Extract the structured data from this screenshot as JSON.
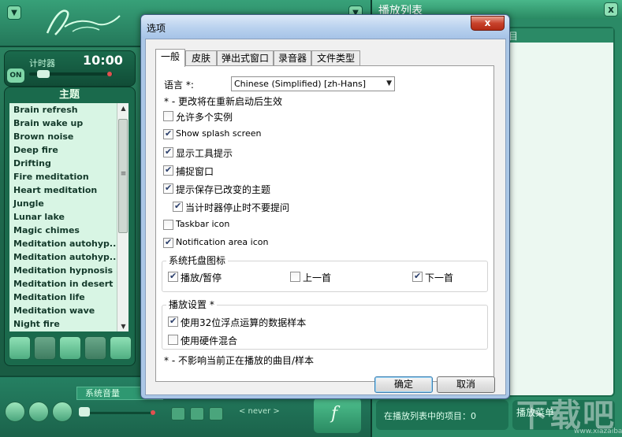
{
  "player": {
    "menu_glyph": "▼",
    "top_right_glyph": "▼",
    "timer": {
      "on_label": "ON",
      "label": "计时器",
      "value": "10:00"
    },
    "theme": {
      "title": "主题",
      "items": [
        "Brain refresh",
        "Brain wake up",
        "Brown noise",
        "Deep fire",
        "Drifting",
        "Fire meditation",
        "Heart meditation",
        "Jungle",
        "Lunar lake",
        "Magic chimes",
        "Meditation autohyp...",
        "Meditation autohyp...",
        "Meditation hypnosis",
        "Meditation in desert",
        "Meditation life",
        "Meditation wave",
        "Night fire"
      ]
    },
    "volume_label": "系统音量",
    "never_label": "< never >"
  },
  "playlist": {
    "title": "播放列表",
    "close_glyph": "x",
    "header_fragment": "目",
    "status": "在播放列表中的项目：0",
    "menu": "播放菜单",
    "watermark": "下载吧",
    "watermark_url": "www.xiazaiba.com"
  },
  "dialog": {
    "title": "选项",
    "close_glyph": "x",
    "tabs": [
      "一般",
      "皮肤",
      "弹出式窗口",
      "录音器",
      "文件类型"
    ],
    "language_label": "语言 *:",
    "language_value": "Chinese (Simplified) [zh-Hans]",
    "restart_note": "* - 更改将在重新启动后生效",
    "options": [
      {
        "label": "允许多个实例",
        "checked": false
      },
      {
        "label": "Show splash screen",
        "checked": true
      },
      {
        "label": "显示工具提示",
        "checked": true
      },
      {
        "label": "捕捉窗口",
        "checked": true
      },
      {
        "label": "提示保存已改变的主题",
        "checked": true
      },
      {
        "label": "当计时器停止时不要提问",
        "checked": true
      },
      {
        "label": "Taskbar icon",
        "checked": false
      },
      {
        "label": "Notification area icon",
        "checked": true
      }
    ],
    "tray_group": {
      "title": "系统托盘图标",
      "items": [
        {
          "label": "播放/暂停",
          "checked": true
        },
        {
          "label": "上一首",
          "checked": false
        },
        {
          "label": "下一首",
          "checked": true
        }
      ]
    },
    "playback_group": {
      "title": "播放设置 *",
      "items": [
        {
          "label": "使用32位浮点运算的数据样本",
          "checked": true
        },
        {
          "label": "使用硬件混合",
          "checked": false
        }
      ]
    },
    "playback_note": "* - 不影响当前正在播放的曲目/样本",
    "ok_label": "确定",
    "cancel_label": "取消"
  }
}
